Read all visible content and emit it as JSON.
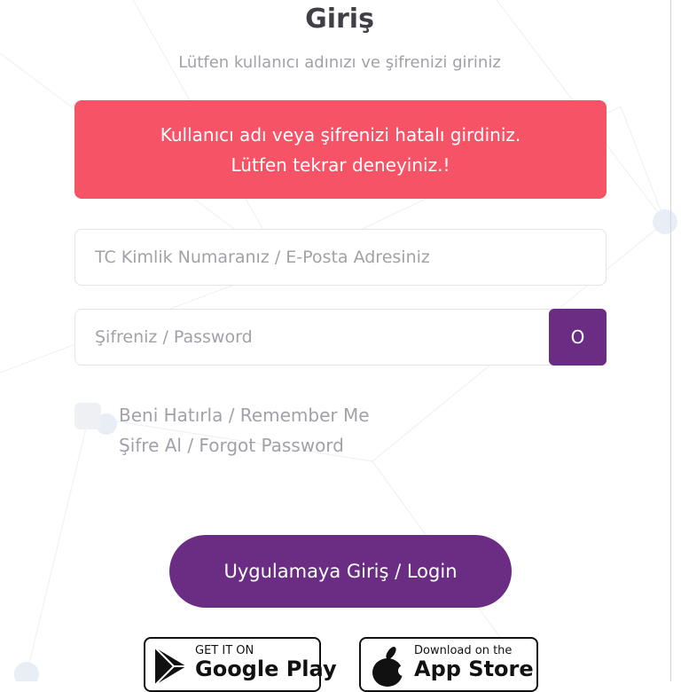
{
  "header": {
    "title": "Giriş",
    "subtitle": "Lütfen kullanıcı adınızı ve şifrenizi giriniz"
  },
  "alert": {
    "line1": "Kullanıcı adı veya şifrenizi hatalı girdiniz.",
    "line2": "Lütfen tekrar deneyiniz.!",
    "color": "#f75366"
  },
  "form": {
    "username_placeholder": "TC Kimlik Numaranız / E-Posta Adresiniz",
    "username_value": "",
    "password_placeholder": "Şifreniz / Password",
    "password_value": "",
    "eye_button_label": "O",
    "remember_label": "Beni Hatırla / Remember Me",
    "forgot_label": "Şifre Al / Forgot Password",
    "login_label": "Uygulamaya Giriş / Login"
  },
  "stores": {
    "google": {
      "small": "GET IT ON",
      "big": "Google Play",
      "icon": "google-play-icon"
    },
    "apple": {
      "small": "Download on the",
      "big": "App Store",
      "icon": "apple-icon"
    }
  },
  "colors": {
    "accent": "#6b2d83",
    "placeholder": "#a1a1aa"
  }
}
